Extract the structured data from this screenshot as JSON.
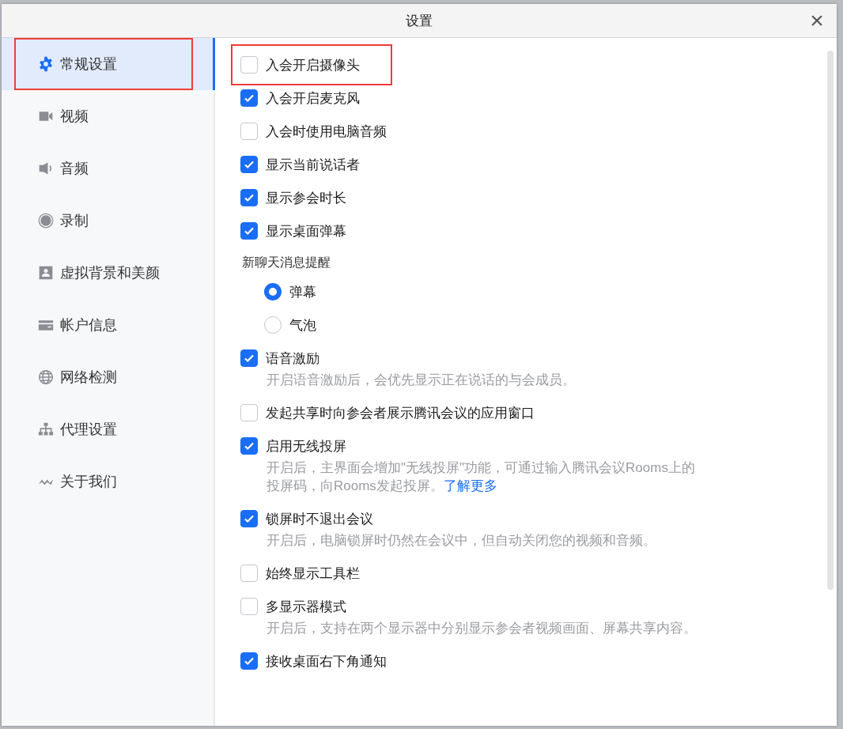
{
  "window": {
    "title": "设置",
    "close": "×"
  },
  "sidebar": {
    "items": [
      {
        "label": "常规设置",
        "selected": true,
        "highlighted": true
      },
      {
        "label": "视频",
        "selected": false,
        "highlighted": false
      },
      {
        "label": "音频",
        "selected": false,
        "highlighted": false
      },
      {
        "label": "录制",
        "selected": false,
        "highlighted": false
      },
      {
        "label": "虚拟背景和美颜",
        "selected": false,
        "highlighted": false
      },
      {
        "label": "帐户信息",
        "selected": false,
        "highlighted": false
      },
      {
        "label": "网络检测",
        "selected": false,
        "highlighted": false
      },
      {
        "label": "代理设置",
        "selected": false,
        "highlighted": false
      },
      {
        "label": "关于我们",
        "selected": false,
        "highlighted": false
      }
    ]
  },
  "settings": [
    {
      "kind": "checkbox",
      "label": "入会开启摄像头",
      "checked": false,
      "highlighted": true
    },
    {
      "kind": "checkbox",
      "label": "入会开启麦克风",
      "checked": true
    },
    {
      "kind": "checkbox",
      "label": "入会时使用电脑音频",
      "checked": false
    },
    {
      "kind": "checkbox",
      "label": "显示当前说话者",
      "checked": true
    },
    {
      "kind": "checkbox",
      "label": "显示参会时长",
      "checked": true
    },
    {
      "kind": "checkbox",
      "label": "显示桌面弹幕",
      "checked": true
    },
    {
      "kind": "heading",
      "label": "新聊天消息提醒"
    },
    {
      "kind": "radio",
      "label": "弹幕",
      "selected": true
    },
    {
      "kind": "radio",
      "label": "气泡",
      "selected": false
    },
    {
      "kind": "checkbox",
      "label": "语音激励",
      "checked": true,
      "description": "开启语音激励后，会优先显示正在说话的与会成员。"
    },
    {
      "kind": "checkbox",
      "label": "发起共享时向参会者展示腾讯会议的应用窗口",
      "checked": false
    },
    {
      "kind": "checkbox",
      "label": "启用无线投屏",
      "checked": true,
      "description": "开启后，主界面会增加\"无线投屏\"功能，可通过输入腾讯会议Rooms上的投屏码，向Rooms发起投屏。",
      "link": "了解更多"
    },
    {
      "kind": "checkbox",
      "label": "锁屏时不退出会议",
      "checked": true,
      "description": "开启后，电脑锁屏时仍然在会议中，但自动关闭您的视频和音频。"
    },
    {
      "kind": "checkbox",
      "label": "始终显示工具栏",
      "checked": false
    },
    {
      "kind": "checkbox",
      "label": "多显示器模式",
      "checked": false,
      "description": "开启后，支持在两个显示器中分别显示参会者视频画面、屏幕共享内容。"
    },
    {
      "kind": "checkbox",
      "label": "接收桌面右下角通知",
      "checked": true
    }
  ]
}
